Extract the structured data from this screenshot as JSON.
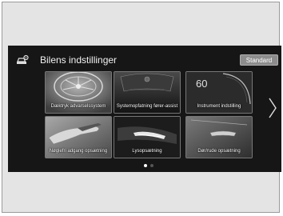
{
  "header": {
    "title": "Bilens indstillinger",
    "standard_label": "Standard",
    "icon": "car-settings-icon"
  },
  "tiles": [
    {
      "label": "Dæktryk advarselssystem",
      "icon": "tire-icon"
    },
    {
      "label": "Systemopfatning fører-assist",
      "icon": "driver-assist-icon"
    },
    {
      "label": "Instrument indstilling",
      "value": "60",
      "icon": "gauge-icon"
    },
    {
      "label": "Nøglefri adgang opsætning",
      "icon": "keyless-hand-icon"
    },
    {
      "label": "Lysopsætning",
      "icon": "headlight-icon"
    },
    {
      "label": "Dør/rude opsætning",
      "icon": "door-handle-icon"
    }
  ],
  "navigation": {
    "next_icon": "chevron-right-icon",
    "page_count": 2,
    "current_page": 1
  },
  "colors": {
    "screen_bg": "#161616",
    "tile_border": "#777777",
    "button_bg": "#8c8c8c"
  }
}
